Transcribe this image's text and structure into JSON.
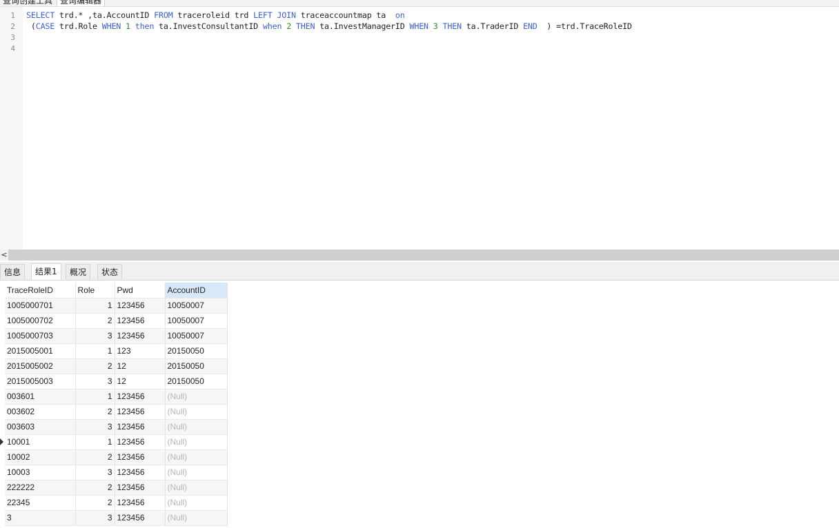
{
  "top_tabs": [
    "查询创建工具",
    "查询编辑器"
  ],
  "editor": {
    "line_numbers": [
      "1",
      "2",
      "3",
      "4"
    ]
  },
  "result_tabs": [
    "信息",
    "结果1",
    "概况",
    "状态"
  ],
  "grid": {
    "columns": [
      "TraceRoleID",
      "Role",
      "Pwd",
      "AccountID"
    ],
    "rows": [
      [
        "1005000701",
        "1",
        "123456",
        "10050007"
      ],
      [
        "1005000702",
        "2",
        "123456",
        "10050007"
      ],
      [
        "1005000703",
        "3",
        "123456",
        "10050007"
      ],
      [
        "2015005001",
        "1",
        "123",
        "20150050"
      ],
      [
        "2015005002",
        "2",
        "12",
        "20150050"
      ],
      [
        "2015005003",
        "3",
        "12",
        "20150050"
      ],
      [
        "003601",
        "1",
        "123456",
        "(Null)"
      ],
      [
        "003602",
        "2",
        "123456",
        "(Null)"
      ],
      [
        "003603",
        "3",
        "123456",
        "(Null)"
      ],
      [
        "10001",
        "1",
        "123456",
        "(Null)"
      ],
      [
        "10002",
        "2",
        "123456",
        "(Null)"
      ],
      [
        "10003",
        "3",
        "123456",
        "(Null)"
      ],
      [
        "222222",
        "2",
        "123456",
        "(Null)"
      ],
      [
        "22345",
        "2",
        "123456",
        "(Null)"
      ],
      [
        "3",
        "3",
        "123456",
        "(Null)"
      ]
    ]
  },
  "colors": {
    "keyword": "#3b5fd6",
    "number": "#2a8f2a",
    "null": "#b5b5b5",
    "selected_header": "#d9e8f8"
  }
}
